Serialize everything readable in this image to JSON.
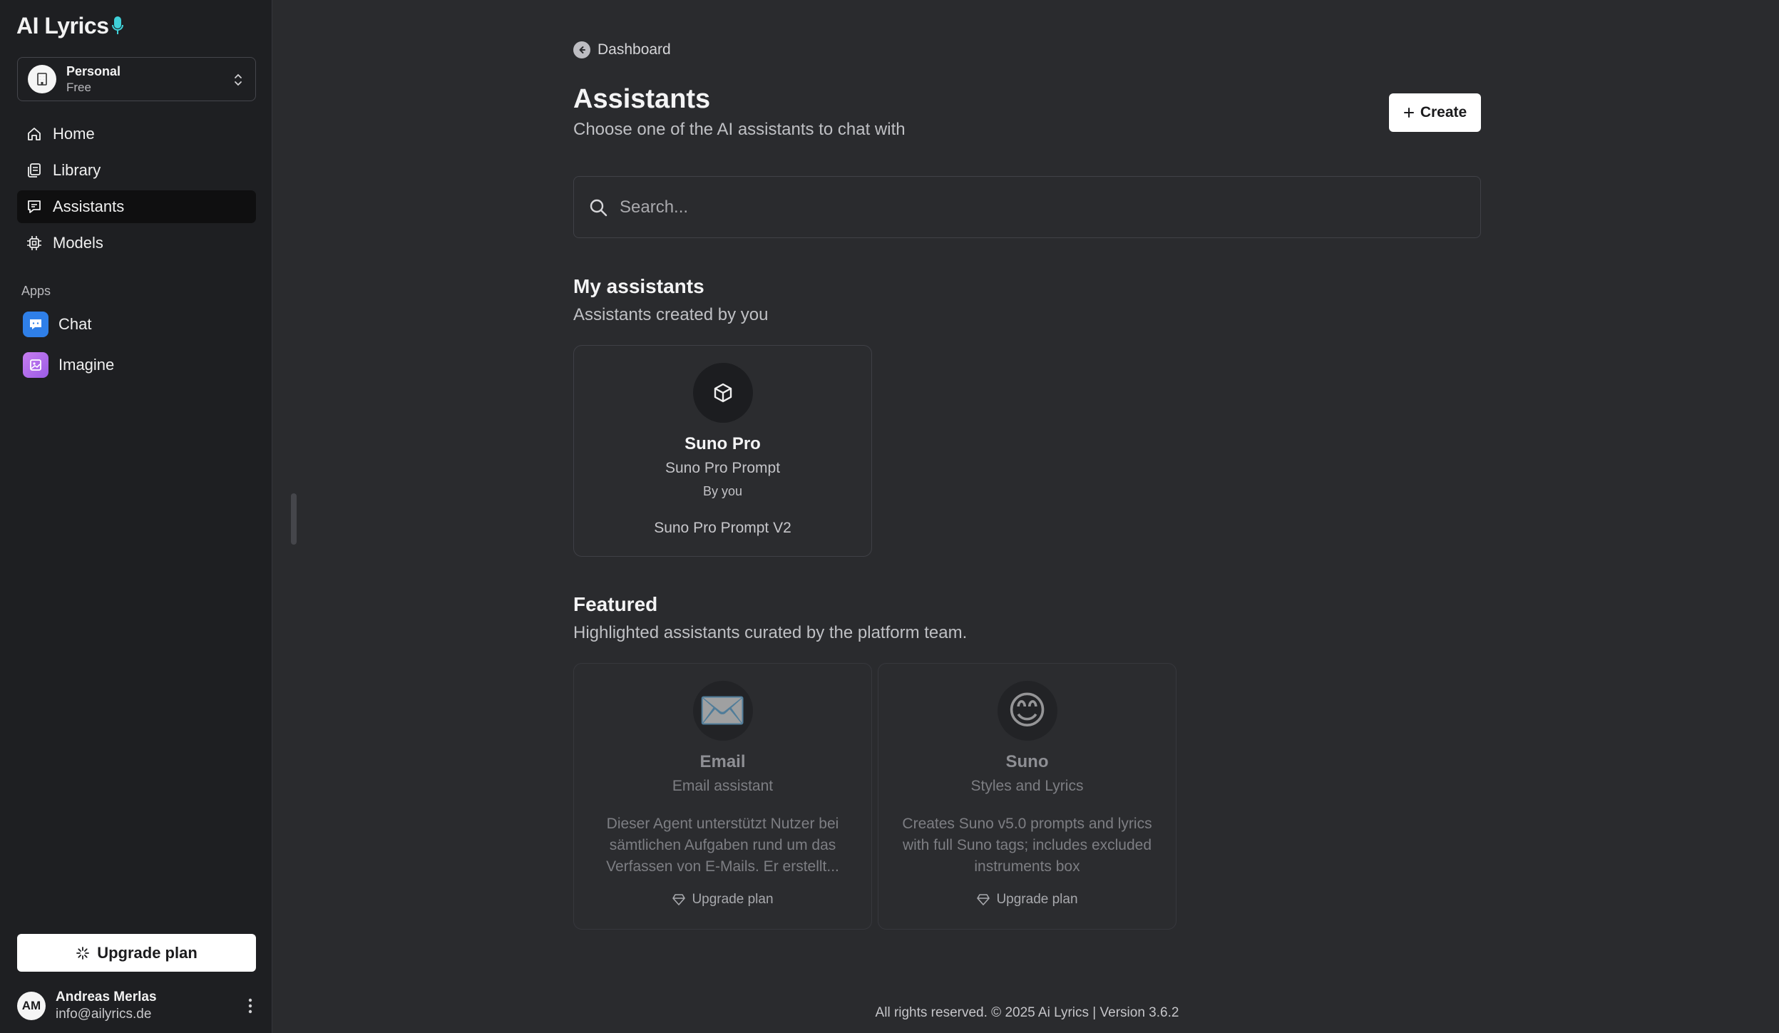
{
  "app": {
    "logo_text": "AI Lyrics"
  },
  "workspace": {
    "name": "Personal",
    "plan": "Free"
  },
  "sidebar": {
    "items": [
      {
        "label": "Home",
        "icon": "home-icon"
      },
      {
        "label": "Library",
        "icon": "library-icon"
      },
      {
        "label": "Assistants",
        "icon": "assistants-icon",
        "active": true
      },
      {
        "label": "Models",
        "icon": "cpu-icon"
      }
    ],
    "apps_label": "Apps",
    "apps": [
      {
        "label": "Chat",
        "icon": "chat-app-icon"
      },
      {
        "label": "Imagine",
        "icon": "imagine-app-icon"
      }
    ],
    "upgrade_label": "Upgrade plan"
  },
  "user": {
    "initials": "AM",
    "name": "Andreas Merlas",
    "email": "info@ailyrics.de"
  },
  "main": {
    "breadcrumb": "Dashboard",
    "title": "Assistants",
    "subtitle": "Choose one of the AI assistants to chat with",
    "create_label": "Create",
    "search_placeholder": "Search...",
    "my_assistants": {
      "title": "My assistants",
      "subtitle": "Assistants created by you",
      "cards": [
        {
          "name": "Suno Pro",
          "category": "Suno Pro Prompt",
          "byline": "By you",
          "description": "Suno Pro Prompt V2",
          "icon": "cube-icon"
        }
      ]
    },
    "featured": {
      "title": "Featured",
      "subtitle": "Highlighted assistants curated by the platform team.",
      "cards": [
        {
          "name": "Email",
          "category": "Email assistant",
          "description": "Dieser Agent unterstützt Nutzer bei sämtlichen Aufgaben rund um das Verfassen von E-Mails. Er erstellt...",
          "emoji": "✉️",
          "upgrade_label": "Upgrade plan"
        },
        {
          "name": "Suno",
          "category": "Styles and Lyrics",
          "description": "Creates Suno v5.0 prompts and lyrics with full Suno tags; includes excluded instruments box",
          "emoji": "😊",
          "upgrade_label": "Upgrade plan"
        }
      ]
    },
    "footer": "All rights reserved. © 2025 Ai Lyrics | Version 3.6.2"
  },
  "colors": {
    "background": "#2a2b2e",
    "sidebar": "#1e1f22",
    "accent_mic": "#3fd0d8",
    "chat_app": "#2f7fe8",
    "imagine_app": "#b06ee9"
  }
}
